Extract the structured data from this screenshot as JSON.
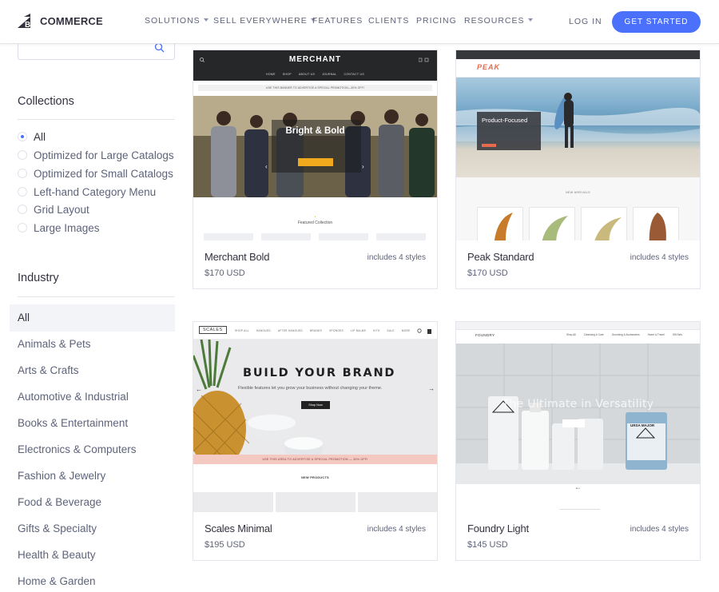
{
  "nav": {
    "logo_text": "COMMERCE",
    "logo_prefix": "BIG",
    "items": [
      {
        "label": "SOLUTIONS",
        "has_caret": true
      },
      {
        "label": "SELL EVERYWHERE",
        "has_caret": true
      },
      {
        "label": "FEATURES",
        "has_caret": false
      },
      {
        "label": "CLIENTS",
        "has_caret": false
      },
      {
        "label": "PRICING",
        "has_caret": false
      },
      {
        "label": "RESOURCES",
        "has_caret": true
      }
    ],
    "login": "LOG IN",
    "cta": "GET STARTED"
  },
  "sidebar": {
    "search": {
      "placeholder": ""
    },
    "collections_heading": "Collections",
    "collections": [
      {
        "label": "All",
        "selected": true
      },
      {
        "label": "Optimized for Large Catalogs",
        "selected": false
      },
      {
        "label": "Optimized for Small Catalogs",
        "selected": false
      },
      {
        "label": "Left-hand Category Menu",
        "selected": false
      },
      {
        "label": "Grid Layout",
        "selected": false
      },
      {
        "label": "Large Images",
        "selected": false
      }
    ],
    "industry_heading": "Industry",
    "industries": [
      {
        "label": "All",
        "selected": true
      },
      {
        "label": "Animals & Pets",
        "selected": false
      },
      {
        "label": "Arts & Crafts",
        "selected": false
      },
      {
        "label": "Automotive & Industrial",
        "selected": false
      },
      {
        "label": "Books & Entertainment",
        "selected": false
      },
      {
        "label": "Electronics & Computers",
        "selected": false
      },
      {
        "label": "Fashion & Jewelry",
        "selected": false
      },
      {
        "label": "Food & Beverage",
        "selected": false
      },
      {
        "label": "Gifts & Specialty",
        "selected": false
      },
      {
        "label": "Health & Beauty",
        "selected": false
      },
      {
        "label": "Home & Garden",
        "selected": false
      }
    ]
  },
  "themes": [
    {
      "name": "Merchant Bold",
      "price": "$170 USD",
      "styles": "includes 4 styles",
      "preview": {
        "logo": "MERCHANT",
        "nav": [
          "HOME",
          "SHOP",
          "ABOUT US",
          "JOURNAL",
          "CONTACT US"
        ],
        "banner": "USE THIS BANNER TO ADVERTISE A SPECIAL PROMOTION—30% OFF!",
        "hero_title": "Bright & Bold",
        "featured": "Featured Collection"
      }
    },
    {
      "name": "Peak Standard",
      "price": "$170 USD",
      "styles": "includes 4 styles",
      "preview": {
        "logo": "PEAK",
        "hero_title": "Product-Focused",
        "arrivals": "NEW ARRIVALS"
      }
    },
    {
      "name": "Scales Minimal",
      "price": "$195 USD",
      "styles": "includes 4 styles",
      "preview": {
        "logo": "SCALES",
        "nav": [
          "SHOP ALL",
          "HANGUED",
          "AFTER HANGUED",
          "BRANDS",
          "SPONGES",
          "LIP BALMS",
          "KITS",
          "SALE",
          "MORE"
        ],
        "hero_title": "BUILD YOUR BRAND",
        "hero_sub": "Flexible features let you grow your business without changing your theme.",
        "button": "Shop Now",
        "promo": "USE THIS AREA TO ADVERTISE A SPECIAL PROMOTION — 30% OFF!",
        "section": "NEW PRODUCTS"
      }
    },
    {
      "name": "Foundry Light",
      "price": "$145 USD",
      "styles": "includes 4 styles",
      "preview": {
        "logo": "FOUNDRY",
        "nav": [
          "Shop All",
          "Cleansing & Care",
          "Grooming & Accessories",
          "Home & Travel",
          "Gift Sets"
        ],
        "hero_title": "The Ultimate in Versatility",
        "product_label": "URSA MAJOR"
      }
    }
  ]
}
